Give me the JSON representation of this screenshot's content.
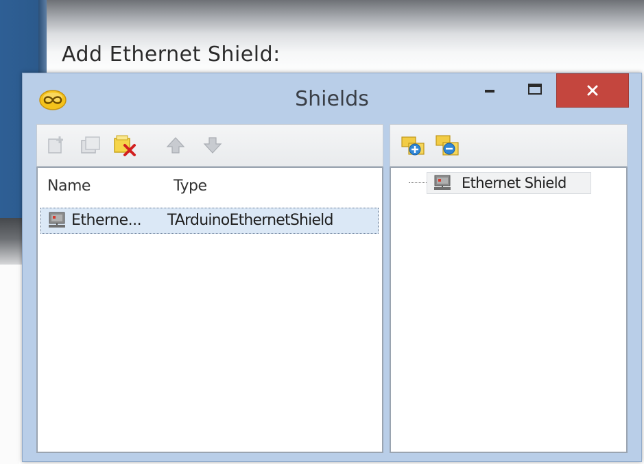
{
  "slide": {
    "heading": "Add Ethernet Shield:"
  },
  "window": {
    "title": "Shields",
    "minimize_glyph": "–",
    "maximize_glyph": "▭",
    "close_glyph": "×",
    "colors": {
      "frame": "#b9cee8",
      "close_button": "#c4463e",
      "selection": "#dbe8f6"
    }
  },
  "toolbar": {
    "left_icons": [
      "add-item-icon",
      "add-item-disabled-icon",
      "delete-icon",
      "move-up-icon",
      "move-down-icon"
    ],
    "right_icons": [
      "expand-all-icon",
      "collapse-all-icon"
    ]
  },
  "list": {
    "columns": [
      "Name",
      "Type"
    ],
    "rows": [
      {
        "name": "Etherne...",
        "type": "TArduinoEthernetShield",
        "selected": true
      }
    ]
  },
  "tree": {
    "nodes": [
      {
        "label": "Ethernet Shield"
      }
    ]
  }
}
